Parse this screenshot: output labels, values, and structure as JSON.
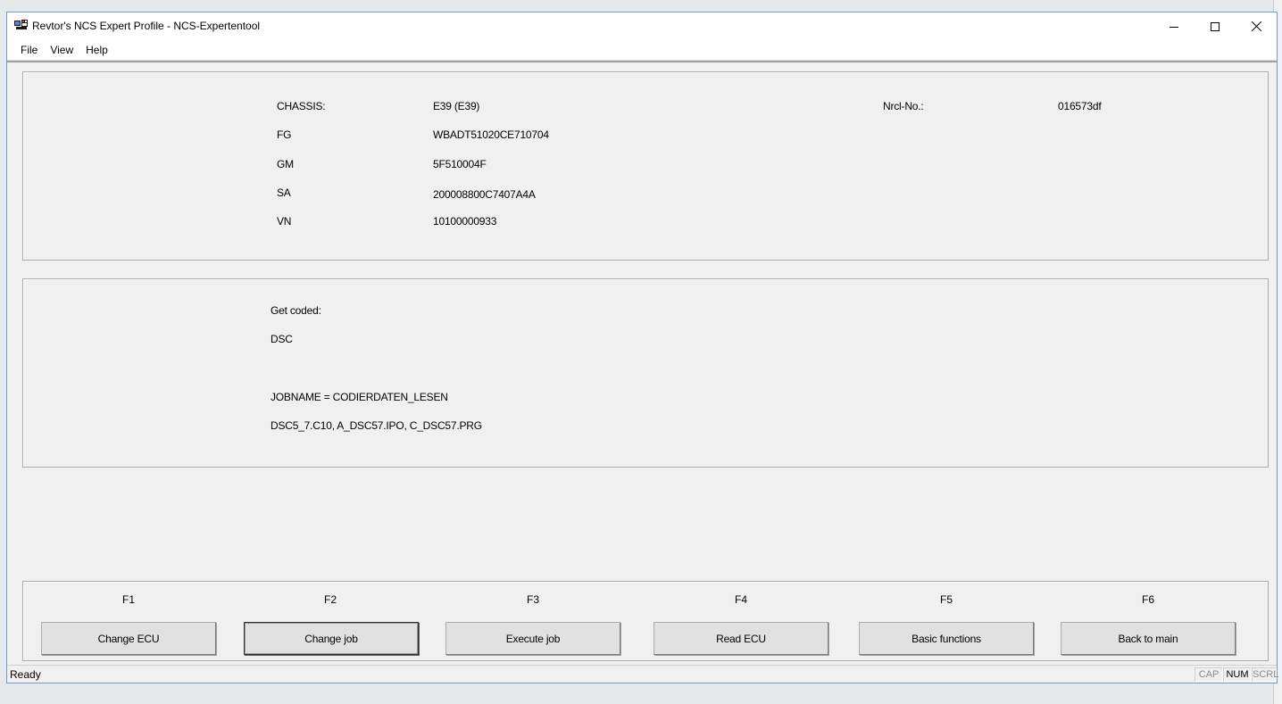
{
  "window": {
    "title": "Revtor's NCS Expert Profile - NCS-Expertentool",
    "icon": "ncs-app-icon"
  },
  "menu": {
    "items": [
      "File",
      "View",
      "Help"
    ]
  },
  "vehicle_info": {
    "chassis_label": "CHASSIS:",
    "chassis_value": "E39 (E39)",
    "fg_label": "FG",
    "fg_value": "WBADT51020CE710704",
    "gm_label": "GM",
    "gm_value": "5F510004F",
    "sa_label": "SA",
    "sa_value": "200008800C7407A4A",
    "vn_label": "VN",
    "vn_value": "10100000933",
    "nrcl_label": "Nrcl-No.:",
    "nrcl_value": "016573df"
  },
  "job_info": {
    "get_coded_label": "Get coded:",
    "ecu": "DSC",
    "jobname": "JOBNAME = CODIERDATEN_LESEN",
    "files": "DSC5_7.C10, A_DSC57.IPO, C_DSC57.PRG"
  },
  "function_keys": [
    {
      "key": "F1",
      "label": "Change ECU"
    },
    {
      "key": "F2",
      "label": "Change job"
    },
    {
      "key": "F3",
      "label": "Execute job"
    },
    {
      "key": "F4",
      "label": "Read ECU"
    },
    {
      "key": "F5",
      "label": "Basic functions"
    },
    {
      "key": "F6",
      "label": "Back to main"
    }
  ],
  "status": {
    "text": "Ready",
    "cap": "CAP",
    "num": "NUM",
    "scrl": "SCRL"
  }
}
